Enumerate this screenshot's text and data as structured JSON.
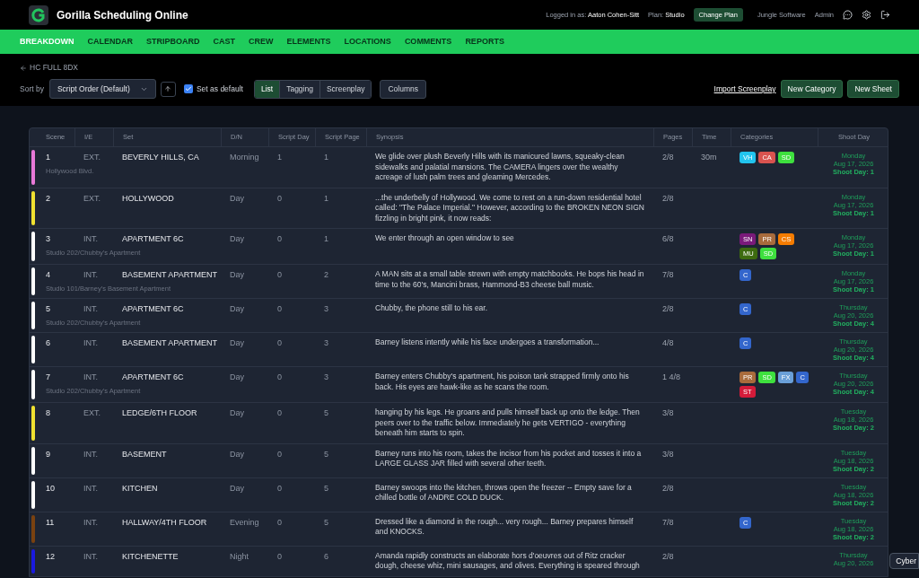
{
  "app": {
    "title": "Gorilla Scheduling Online",
    "logged_in_label": "Logged in as:",
    "user": "Aaton Cohen-Sitt",
    "plan_label": "Plan:",
    "plan": "Studio",
    "change_plan": "Change Plan",
    "company": "Jungle Software",
    "admin": "Admin"
  },
  "nav": [
    {
      "label": "BREAKDOWN",
      "selected": true
    },
    {
      "label": "CALENDAR",
      "selected": false
    },
    {
      "label": "STRIPBOARD",
      "selected": false
    },
    {
      "label": "CAST",
      "selected": false
    },
    {
      "label": "CREW",
      "selected": false
    },
    {
      "label": "ELEMENTS",
      "selected": false
    },
    {
      "label": "LOCATIONS",
      "selected": false
    },
    {
      "label": "COMMENTS",
      "selected": false
    },
    {
      "label": "REPORTS",
      "selected": false
    }
  ],
  "toolbar": {
    "back": "HC FULL 8DX",
    "sort_label": "Sort by",
    "sort_value": "Script Order (Default)",
    "set_default": {
      "label": "Set as default",
      "checked": true
    },
    "views": [
      {
        "label": "List",
        "selected": true
      },
      {
        "label": "Tagging",
        "selected": false
      },
      {
        "label": "Screenplay",
        "selected": false
      }
    ],
    "columns": "Columns",
    "import": "Import Screenplay",
    "new_category": "New Category",
    "new_sheet": "New Sheet"
  },
  "table": {
    "columns": [
      "Scene",
      "I/E",
      "Set",
      "D/N",
      "Script Day",
      "Script Page",
      "Synopsis",
      "Pages",
      "Time",
      "Categories",
      "Shoot Day"
    ],
    "rows": [
      {
        "color": "#e879d8",
        "scene": "1",
        "ie": "EXT.",
        "set": "BEVERLY HILLS, CA",
        "location": "Hollywood Blvd.",
        "dn": "Morning",
        "script_day": "1",
        "script_page": "1",
        "synopsis": "We glide over plush Beverly Hills with its manicured lawns, squeaky-clean sidewalks and palatial mansions. The CAMERA lingers over the wealthy acreage of lush palm trees and gleaming Mercedes.",
        "pages": "2/8",
        "time": "30m",
        "categories": [
          {
            "label": "VH",
            "color": "#22c4ee"
          },
          {
            "label": "CA",
            "color": "#d9534f"
          },
          {
            "label": "SD",
            "color": "#3ee03e"
          }
        ],
        "shoot_day": {
          "weekday": "Monday",
          "date": "Aug 17, 2026",
          "day": "Shoot Day: 1"
        }
      },
      {
        "color": "#f0e130",
        "scene": "2",
        "ie": "EXT.",
        "set": "HOLLYWOOD",
        "dn": "Day",
        "script_day": "0",
        "script_page": "1",
        "synopsis": "...the underbelly of Hollywood. We come to rest on a run-down residential hotel called: \"The Palace Imperial.\" However, according to the BROKEN NEON SIGN fizzling in bright pink, it now reads:",
        "pages": "2/8",
        "categories": [],
        "shoot_day": {
          "weekday": "Monday",
          "date": "Aug 17, 2026",
          "day": "Shoot Day: 1"
        }
      },
      {
        "color": "#ffffff",
        "scene": "3",
        "ie": "INT.",
        "set": "APARTMENT 6C",
        "location": "Studio 202/Chubby's Apartment",
        "dn": "Day",
        "script_day": "0",
        "script_page": "1",
        "synopsis": "We enter through an open window to see",
        "pages": "6/8",
        "categories": [
          {
            "label": "SN",
            "color": "#7a1a7a"
          },
          {
            "label": "PR",
            "color": "#a86b3c"
          },
          {
            "label": "CS",
            "color": "#f57c00"
          },
          {
            "label": "MU",
            "color": "#3d6b0f"
          },
          {
            "label": "SD",
            "color": "#3ee03e"
          }
        ],
        "shoot_day": {
          "weekday": "Monday",
          "date": "Aug 17, 2026",
          "day": "Shoot Day: 1"
        }
      },
      {
        "color": "#ffffff",
        "scene": "4",
        "ie": "INT.",
        "set": "BASEMENT APARTMENT",
        "location": "Studio 101/Barney's Basement Apartment",
        "dn": "Day",
        "script_day": "0",
        "script_page": "2",
        "synopsis": "A MAN sits at a small table strewn with empty matchbooks. He bops his head in time to the 60's, Mancini brass, Hammond-B3 cheese ball music.",
        "pages": "7/8",
        "categories": [
          {
            "label": "C",
            "color": "#3366cc"
          }
        ],
        "shoot_day": {
          "weekday": "Monday",
          "date": "Aug 17, 2026",
          "day": "Shoot Day: 1"
        }
      },
      {
        "color": "#ffffff",
        "scene": "5",
        "ie": "INT.",
        "set": "APARTMENT 6C",
        "location": "Studio 202/Chubby's Apartment",
        "dn": "Day",
        "script_day": "0",
        "script_page": "3",
        "synopsis": "Chubby, the phone still to his ear.",
        "pages": "2/8",
        "categories": [
          {
            "label": "C",
            "color": "#3366cc"
          }
        ],
        "shoot_day": {
          "weekday": "Thursday",
          "date": "Aug 20, 2026",
          "day": "Shoot Day: 4"
        }
      },
      {
        "color": "#ffffff",
        "scene": "6",
        "ie": "INT.",
        "set": "BASEMENT APARTMENT",
        "dn": "Day",
        "script_day": "0",
        "script_page": "3",
        "synopsis": "Barney listens intently while his face undergoes a transformation...",
        "pages": "4/8",
        "categories": [
          {
            "label": "C",
            "color": "#3366cc"
          }
        ],
        "shoot_day": {
          "weekday": "Thursday",
          "date": "Aug 20, 2026",
          "day": "Shoot Day: 4"
        }
      },
      {
        "color": "#ffffff",
        "scene": "7",
        "ie": "INT.",
        "set": "APARTMENT 6C",
        "location": "Studio 202/Chubby's Apartment",
        "dn": "Day",
        "script_day": "0",
        "script_page": "3",
        "synopsis": "Barney enters Chubby's apartment, his poison tank strapped firmly onto his back. His eyes are hawk-like as he scans the room.",
        "pages": "1 4/8",
        "categories": [
          {
            "label": "PR",
            "color": "#a86b3c"
          },
          {
            "label": "SD",
            "color": "#3ee03e"
          },
          {
            "label": "FX",
            "color": "#6a9fd8"
          },
          {
            "label": "C",
            "color": "#3366cc"
          },
          {
            "label": "ST",
            "color": "#d41b3a"
          }
        ],
        "shoot_day": {
          "weekday": "Thursday",
          "date": "Aug 20, 2026",
          "day": "Shoot Day: 4"
        }
      },
      {
        "color": "#f0e130",
        "scene": "8",
        "ie": "EXT.",
        "set": "LEDGE/6TH FLOOR",
        "dn": "Day",
        "script_day": "0",
        "script_page": "5",
        "synopsis": "hanging by his legs. He groans and pulls himself back up onto the ledge. Then peers over to the traffic below. Immediately he gets VERTIGO - everything beneath him starts to spin.",
        "pages": "3/8",
        "categories": [],
        "shoot_day": {
          "weekday": "Tuesday",
          "date": "Aug 18, 2026",
          "day": "Shoot Day: 2"
        }
      },
      {
        "color": "#ffffff",
        "scene": "9",
        "ie": "INT.",
        "set": "BASEMENT",
        "dn": "Day",
        "script_day": "0",
        "script_page": "5",
        "synopsis": "Barney runs into his room, takes the incisor from his pocket and tosses it into a LARGE GLASS JAR filled with several other teeth.",
        "pages": "3/8",
        "categories": [],
        "shoot_day": {
          "weekday": "Tuesday",
          "date": "Aug 18, 2026",
          "day": "Shoot Day: 2"
        }
      },
      {
        "color": "#ffffff",
        "scene": "10",
        "ie": "INT.",
        "set": "KITCHEN",
        "dn": "Day",
        "script_day": "0",
        "script_page": "5",
        "synopsis": "Barney swoops into the kitchen, throws open the freezer -- Empty save for a chilled bottle of ANDRE COLD DUCK.",
        "pages": "2/8",
        "categories": [],
        "shoot_day": {
          "weekday": "Tuesday",
          "date": "Aug 18, 2026",
          "day": "Shoot Day: 2"
        }
      },
      {
        "color": "#7a4210",
        "scene": "11",
        "ie": "INT.",
        "set": "HALLWAY/4TH FLOOR",
        "dn": "Evening",
        "script_day": "0",
        "script_page": "5",
        "synopsis": "Dressed like a diamond in the rough... very rough... Barney prepares himself and KNOCKS.",
        "pages": "7/8",
        "categories": [
          {
            "label": "C",
            "color": "#3366cc"
          }
        ],
        "shoot_day": {
          "weekday": "Tuesday",
          "date": "Aug 18, 2026",
          "day": "Shoot Day: 2"
        }
      },
      {
        "color": "#1a1adf",
        "scene": "12",
        "ie": "INT.",
        "set": "KITCHENETTE",
        "dn": "Night",
        "script_day": "0",
        "script_page": "6",
        "synopsis": "Amanda rapidly constructs an elaborate hors d'oeuvres out of Ritz cracker dough, cheese whiz, mini sausages, and olives. Everything is speared through",
        "pages": "2/8",
        "categories": [],
        "shoot_day": {
          "weekday": "Thursday",
          "date": "Aug 20, 2026"
        }
      }
    ]
  },
  "tooltip": "Cyber"
}
